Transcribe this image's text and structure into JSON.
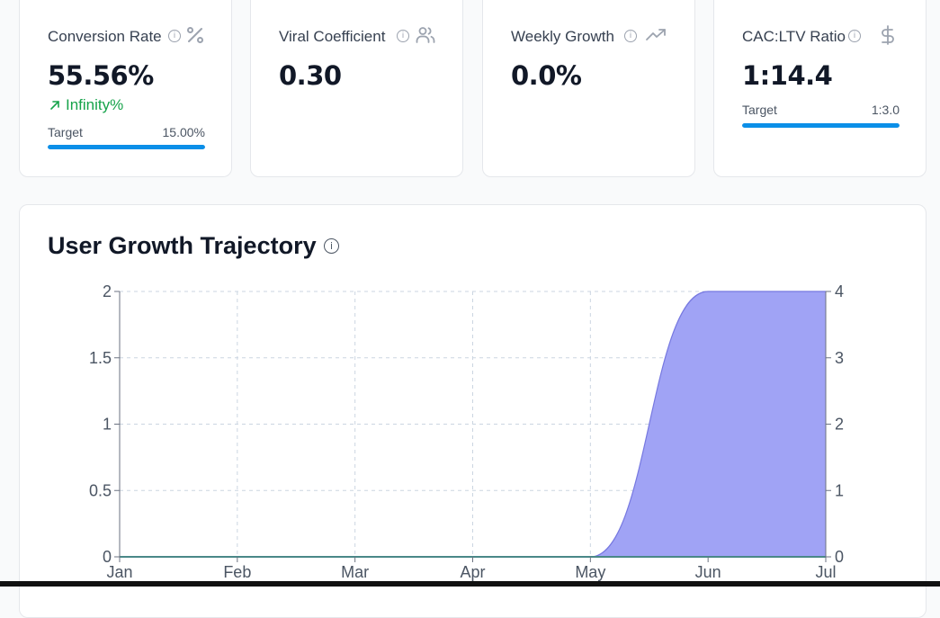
{
  "metrics": [
    {
      "title": "Conversion Rate",
      "info": "i",
      "icon": "percent-icon",
      "value": "55.56%",
      "change": "Infinity%",
      "target_label": "Target",
      "target_value": "15.00%",
      "target_progress": 1.0
    },
    {
      "title": "Viral Coefficient",
      "info": "i",
      "icon": "users-icon",
      "value": "0.30"
    },
    {
      "title": "Weekly Growth",
      "info": "i",
      "icon": "trending-up-icon",
      "value": "0.0%"
    },
    {
      "title": "CAC:LTV Ratio",
      "info": "i",
      "icon": "dollar-icon",
      "value": "1:14.4",
      "target_label": "Target",
      "target_value": "1:3.0",
      "target_progress": 1.0
    }
  ],
  "colors": {
    "accent": "#0b8fe8",
    "positive": "#16a34a",
    "area_fill": "#a0a3f5",
    "area_stroke": "#7678e0",
    "baseline_series": "#2a9d8f"
  },
  "chart": {
    "title": "User Growth Trajectory",
    "info": "i"
  },
  "chart_data": {
    "type": "area",
    "title": "User Growth Trajectory",
    "x": [
      "Jan",
      "Feb",
      "Mar",
      "Apr",
      "May",
      "Jun",
      "Jul"
    ],
    "series": [
      {
        "axis": "left",
        "values": [
          0,
          0,
          0,
          0,
          0,
          0,
          0
        ]
      },
      {
        "axis": "right",
        "values": [
          0,
          0,
          0,
          0,
          0,
          4,
          4
        ]
      }
    ],
    "ylim_left": [
      0,
      2
    ],
    "yticks_left": [
      "0",
      "0.5",
      "1",
      "1.5",
      "2"
    ],
    "ylim_right": [
      0,
      4
    ],
    "yticks_right": [
      "0",
      "1",
      "2",
      "3",
      "4"
    ],
    "grid": true
  }
}
